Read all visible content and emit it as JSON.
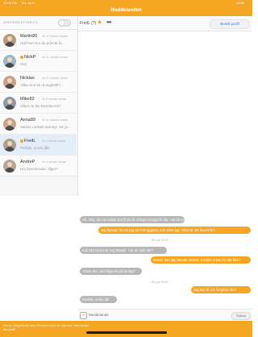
{
  "status_bar": {
    "time": "12:05 PM",
    "date": "Tue Jul 9",
    "battery": "100%"
  },
  "nav": {
    "title": "Meddelanden"
  },
  "filter": {
    "label": "SORTERA EFTER (?)"
  },
  "contacts": [
    {
      "name": "Martin86",
      "time": "för 19 minuter sedan",
      "message": "Hall hur! Hur du prinnat fo...",
      "online": false
    },
    {
      "name": "NickP",
      "time": "för 11 minuter sedan",
      "message": "Hej!",
      "online": true
    },
    {
      "name": "Nicklas",
      "time": "för 24 minuter sedan",
      "message": "Vilka vind ek ut augbokl?...",
      "online": false
    },
    {
      "name": "Mike82",
      "time": "för 8 minuter sedan",
      "message": "Vilken är din favoritsorts?",
      "online": false
    },
    {
      "name": "Anna89",
      "time": "för 11 minuter sedan",
      "message": "Vadom runkale äventyr. Ne ja...",
      "online": false
    },
    {
      "name": "FredL",
      "time": "för 1 timmar sedan",
      "message": "Perfekt, vi ses då!",
      "online": true
    },
    {
      "name": "AndreP",
      "time": "för 4 minuter sedan",
      "message": "Hej favoriterade, digar?",
      "online": false
    }
  ],
  "chat": {
    "name": "FredL (?)",
    "profile_button": "Besök profil",
    "messages": [
      {
        "dir": "in",
        "text": "Ah, okej, det var kalas! Det finns så många mysiga fik där. Har du testat där länge?"
      },
      {
        "dir": "out",
        "text": "Jag flyttade hit när jag var mitt tjugotal, runt 2005 typ. Vilket är ditt favorit fik?"
      },
      {
        "dir": "sep",
        "text": "04 juli 2019"
      },
      {
        "dir": "in",
        "text": "Kul! Min favorit är nog Mataje. Har du varit där?"
      },
      {
        "dir": "out",
        "text": "Manze hon jag hakade neutral. Kanske vi kan ha där fika?"
      },
      {
        "dir": "in",
        "text": "Gärna det, vad säga om på lördag?"
      },
      {
        "dir": "sep",
        "text": "04 juli 2019"
      },
      {
        "dir": "out",
        "text": "Jag kan kl. 10, lunglove din?"
      },
      {
        "dir": "in",
        "text": "Perfekt, vi ses då!"
      }
    ]
  },
  "input": {
    "placeholder": "Meddelande",
    "send_label": "Skicka"
  },
  "banner": {
    "text": "Prova obegränsat med Premium och se alla som har besökt din profil"
  },
  "colors": {
    "accent": "#f5a623",
    "incoming": "#b8b8b8",
    "link": "#3a80c9"
  }
}
